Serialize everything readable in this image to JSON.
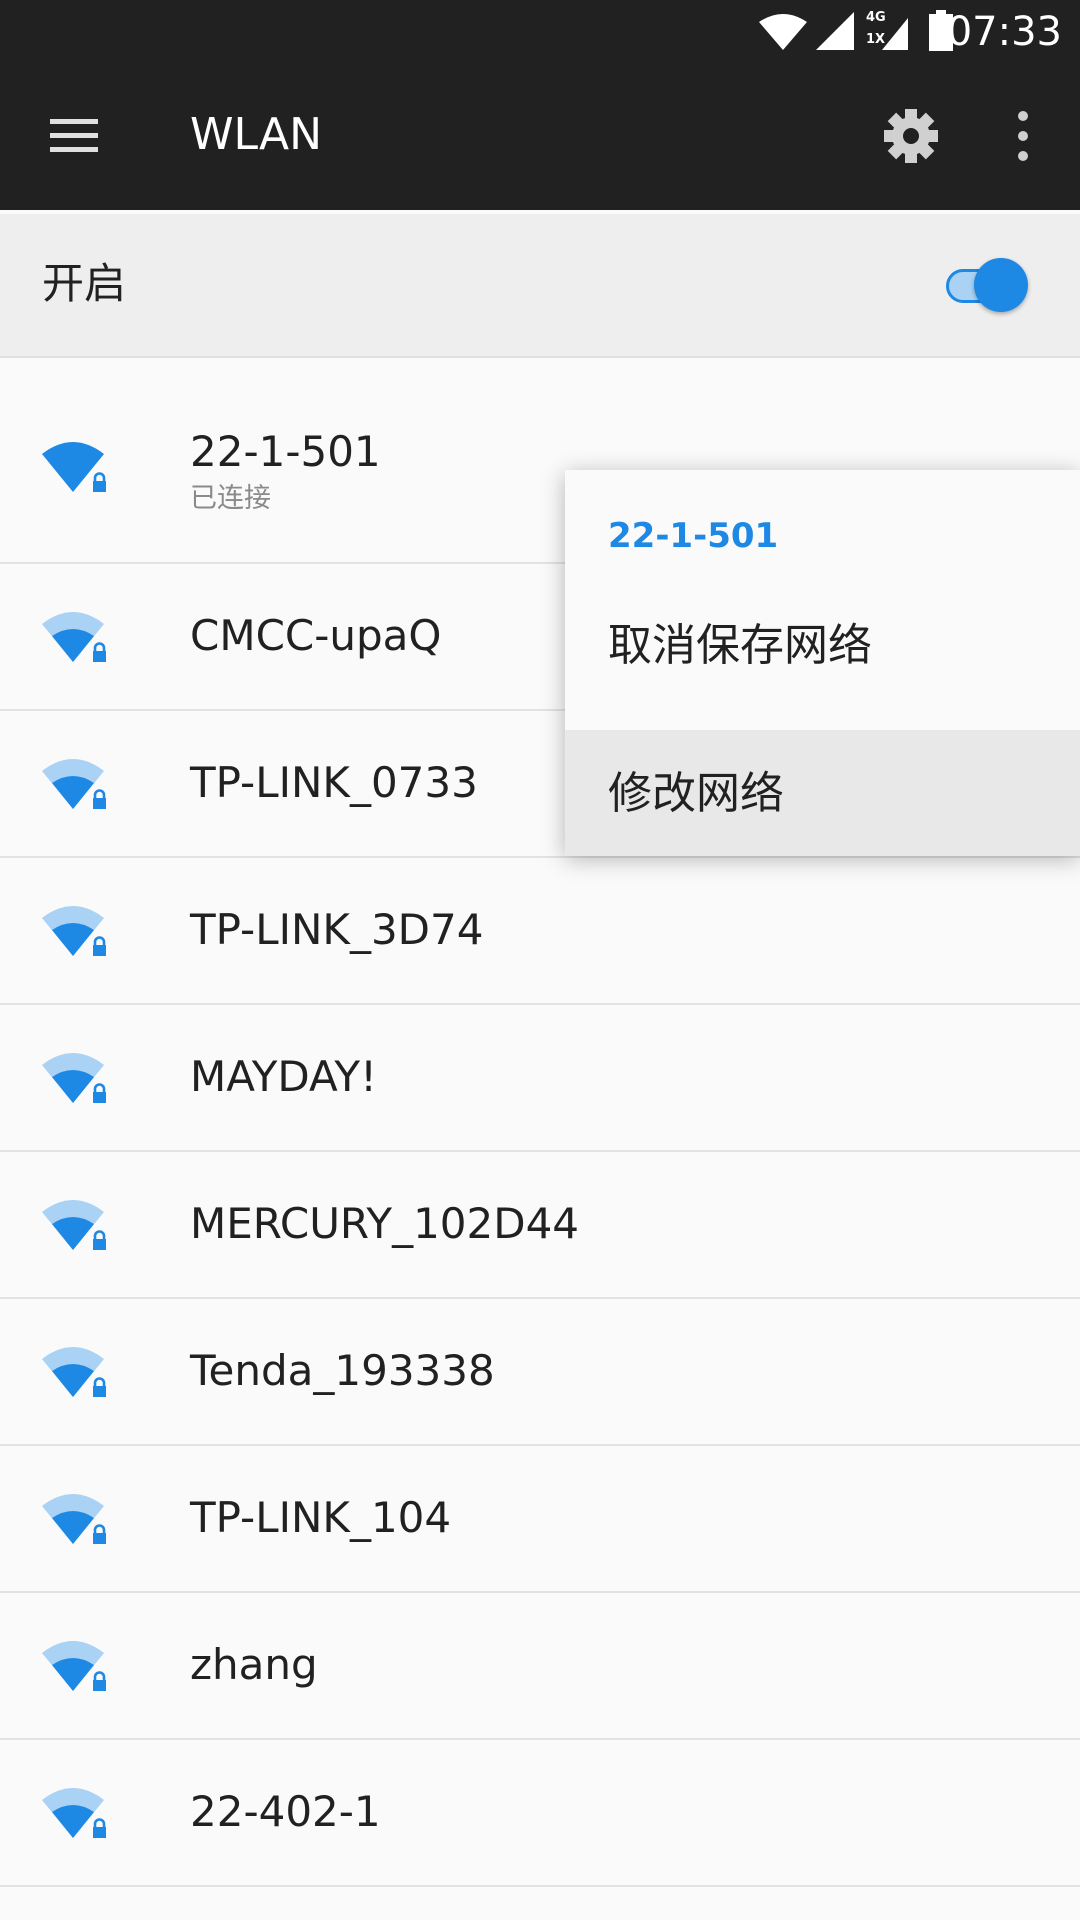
{
  "status_bar": {
    "time": "07:33",
    "network_label_top": "4G",
    "network_label_bottom": "1X",
    "icons": [
      "wifi-icon",
      "cell-signal-icon",
      "data-signal-icon",
      "battery-icon"
    ]
  },
  "app_bar": {
    "title": "WLAN",
    "icons": [
      "menu-icon",
      "gear-icon",
      "overflow-icon"
    ]
  },
  "toggle": {
    "label": "开启",
    "state": "on"
  },
  "networks": [
    {
      "name": "22-1-501",
      "status": "已连接"
    },
    {
      "name": "CMCC-upaQ"
    },
    {
      "name": "TP-LINK_0733"
    },
    {
      "name": "TP-LINK_3D74"
    },
    {
      "name": "MAYDAY!"
    },
    {
      "name": "MERCURY_102D44"
    },
    {
      "name": "Tenda_193338"
    },
    {
      "name": "TP-LINK_104"
    },
    {
      "name": "zhang"
    },
    {
      "name": "22-402-1"
    }
  ],
  "popup": {
    "title": "22-1-501",
    "items": [
      "取消保存网络",
      "修改网络"
    ]
  },
  "colors": {
    "accent": "#1e88e5",
    "toolbar": "#212121",
    "wifi_full": "#1e88e5",
    "wifi_dim": "#a9d2f5"
  }
}
